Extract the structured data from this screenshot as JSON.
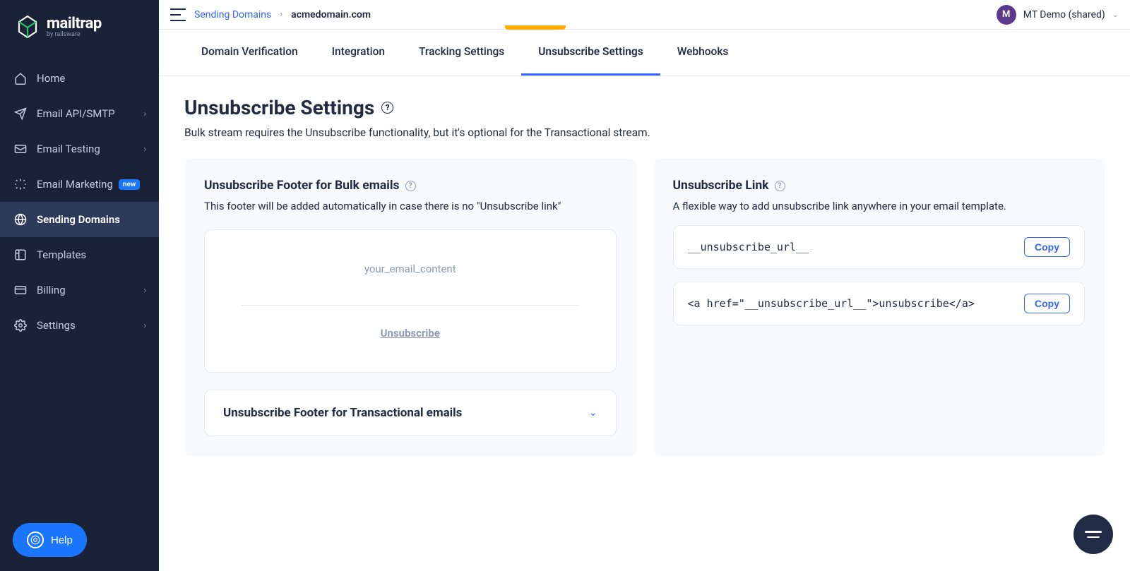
{
  "brand": {
    "name": "mailtrap",
    "byline": "by railsware"
  },
  "sidebar": {
    "items": [
      {
        "label": "Home"
      },
      {
        "label": "Email API/SMTP",
        "chevron": true
      },
      {
        "label": "Email Testing",
        "chevron": true
      },
      {
        "label": "Email Marketing",
        "badge": "new"
      },
      {
        "label": "Sending Domains",
        "active": true
      },
      {
        "label": "Templates"
      },
      {
        "label": "Billing",
        "chevron": true
      },
      {
        "label": "Settings",
        "chevron": true
      }
    ],
    "help_label": "Help"
  },
  "breadcrumb": {
    "parent": "Sending Domains",
    "current": "acmedomain.com"
  },
  "user": {
    "initial": "M",
    "label": "MT Demo (shared)"
  },
  "tabs": [
    {
      "label": "Domain Verification"
    },
    {
      "label": "Integration"
    },
    {
      "label": "Tracking Settings"
    },
    {
      "label": "Unsubscribe Settings",
      "active": true
    },
    {
      "label": "Webhooks"
    }
  ],
  "page": {
    "title": "Unsubscribe Settings",
    "description": "Bulk stream requires the Unsubscribe functionality, but it's optional for the Transactional stream."
  },
  "footer_card": {
    "title": "Unsubscribe Footer for Bulk emails",
    "description": "This footer will be added automatically in case there is no \"Unsubscribe link\"",
    "preview_placeholder": "your_email_content",
    "preview_link": "Unsubscribe",
    "accordion_title": "Unsubscribe Footer for Transactional emails"
  },
  "link_card": {
    "title": "Unsubscribe Link",
    "description": "A flexible way to add unsubscribe link anywhere in your email template.",
    "code1": "__unsubscribe_url__",
    "code2": "<a href=\"__unsubscribe_url__\">unsubscribe</a>",
    "copy_label": "Copy"
  }
}
